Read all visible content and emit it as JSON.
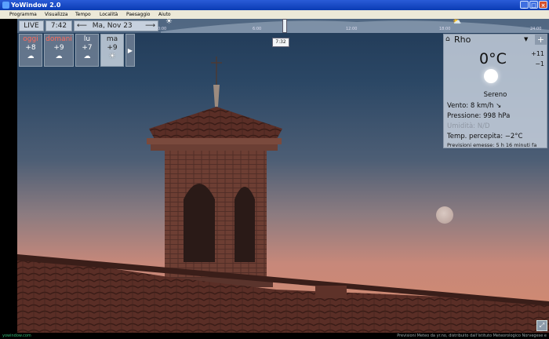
{
  "window": {
    "title": "YoWindow 2.0"
  },
  "menu": [
    "Programma",
    "Visualizza",
    "Tempo",
    "Località",
    "Paesaggio",
    "Aiuto"
  ],
  "controls": {
    "live": "LIVE",
    "time": "7:42",
    "prev_arrow": "⟵",
    "date": "Ma, Nov 23",
    "next_arrow": "⟶"
  },
  "timeline": {
    "ticks": [
      "0:00",
      "6:00",
      "12:00",
      "18:00",
      "24:00"
    ],
    "current": "7:32"
  },
  "forecast": [
    {
      "name": "oggi",
      "temp": "+8",
      "icon": "rain-cloud-icon",
      "glyph": "☁"
    },
    {
      "name": "domani",
      "temp": "+9",
      "icon": "rain-cloud-icon",
      "glyph": "☁"
    },
    {
      "name": "lu",
      "temp": "+7",
      "icon": "rain-cloud-icon",
      "glyph": "☁"
    },
    {
      "name": "ma",
      "temp": "+9",
      "icon": "sun-icon",
      "glyph": "☀"
    }
  ],
  "panel": {
    "location": "Rho",
    "temp": "0°C",
    "high": "+11",
    "low": "−1",
    "condition": "Sereno",
    "wind": "Vento:  8 km/h  ↘",
    "pressure": "Pressione:  998 hPa",
    "humidity": "Umidità:  N/D",
    "feels": "Temp. percepita:  −2°C",
    "issued": "Previsioni emesse:  5 h 16 minuti fa"
  },
  "status": {
    "left": "yowindow.com",
    "right": "Previsioni Meteo da yr.no, distribuito dall'Istituto Meteorologico Norvegese e"
  },
  "colors": {
    "day_label": "#ff6a5a"
  }
}
